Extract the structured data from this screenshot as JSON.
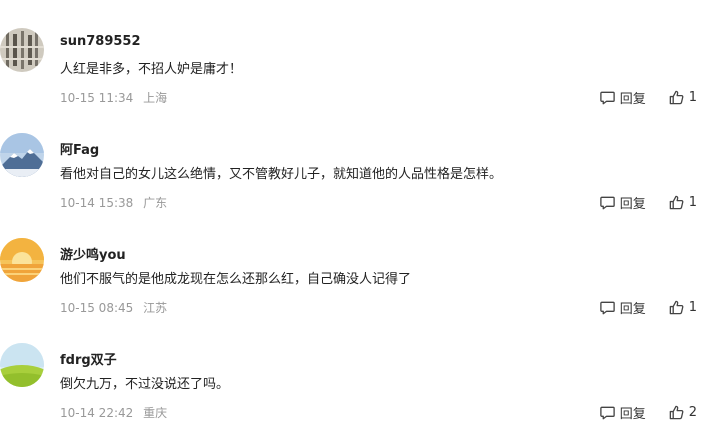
{
  "comments": [
    {
      "username": "sun789552",
      "content": "人红是非多，不招人妒是庸才！",
      "time": "10-15 11:34",
      "location": "上海",
      "reply_label": "回复",
      "likes": "1",
      "avatar": "calligraphy-avatar"
    },
    {
      "username": "阿Fag",
      "content": "看他对自己的女儿这么绝情，又不管教好儿子，就知道他的人品性格是怎样。",
      "time": "10-14 15:38",
      "location": "广东",
      "reply_label": "回复",
      "likes": "1",
      "avatar": "snow-mountain-avatar"
    },
    {
      "username": "游少鸣you",
      "content": "他们不服气的是他成龙现在怎么还那么红，自己确没人记得了",
      "time": "10-15 08:45",
      "location": "江苏",
      "reply_label": "回复",
      "likes": "1",
      "avatar": "sunset-avatar"
    },
    {
      "username": "fdrg双子",
      "content": "倒欠九万，不过没说还了吗。",
      "time": "10-14 22:42",
      "location": "重庆",
      "reply_label": "回复",
      "likes": "2",
      "avatar": "green-field-avatar"
    }
  ],
  "icons": {
    "reply": "chat-bubble-icon",
    "like": "thumbs-up-icon"
  },
  "colors": {
    "text": "#222222",
    "meta": "#999999",
    "background": "#ffffff"
  }
}
